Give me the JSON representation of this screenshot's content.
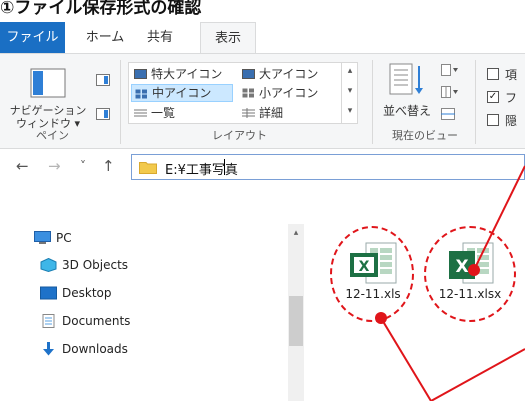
{
  "document": {
    "heading": "①ファイル保存形式の確認"
  },
  "tabs": [
    {
      "label": "ファイル"
    },
    {
      "label": "ホーム"
    },
    {
      "label": "共有"
    },
    {
      "label": "表示"
    }
  ],
  "ribbon": {
    "pane_group": {
      "nav_pane_label_line1": "ナビゲーション",
      "nav_pane_label_line2": "ウィンドウ ▾",
      "group_label": "ペイン"
    },
    "layout_group": {
      "items": [
        {
          "label": "特大アイコン"
        },
        {
          "label": "大アイコン"
        },
        {
          "label": "中アイコン",
          "selected": true
        },
        {
          "label": "小アイコン"
        },
        {
          "label": "一覧"
        },
        {
          "label": "詳細"
        }
      ],
      "group_label": "レイアウト"
    },
    "current_view_group": {
      "sort_label": "並べ替え",
      "group_label": "現在のビュー"
    },
    "show_hide_group": {
      "checkboxes": [
        {
          "label": "項",
          "checked": false
        },
        {
          "label": "フ",
          "checked": true
        },
        {
          "label": "隠",
          "checked": false
        }
      ]
    }
  },
  "address_bar": {
    "back_icon": "←",
    "forward_icon": "→",
    "recent_icon": "˅",
    "up_icon": "↑",
    "path": "E:¥工事写真"
  },
  "nav_tree": {
    "items": [
      {
        "label": "PC",
        "icon": "pc-icon"
      },
      {
        "label": "3D Objects",
        "icon": "3d-objects-icon"
      },
      {
        "label": "Desktop",
        "icon": "desktop-icon"
      },
      {
        "label": "Documents",
        "icon": "documents-icon"
      },
      {
        "label": "Downloads",
        "icon": "downloads-icon"
      }
    ]
  },
  "files": [
    {
      "name": "12-11.xls",
      "type": "xls"
    },
    {
      "name": "12-11.xlsx",
      "type": "xlsx"
    }
  ],
  "colors": {
    "accent": "#1a6fc4",
    "annotation": "#e0151a",
    "excel_green": "#1d7044"
  }
}
